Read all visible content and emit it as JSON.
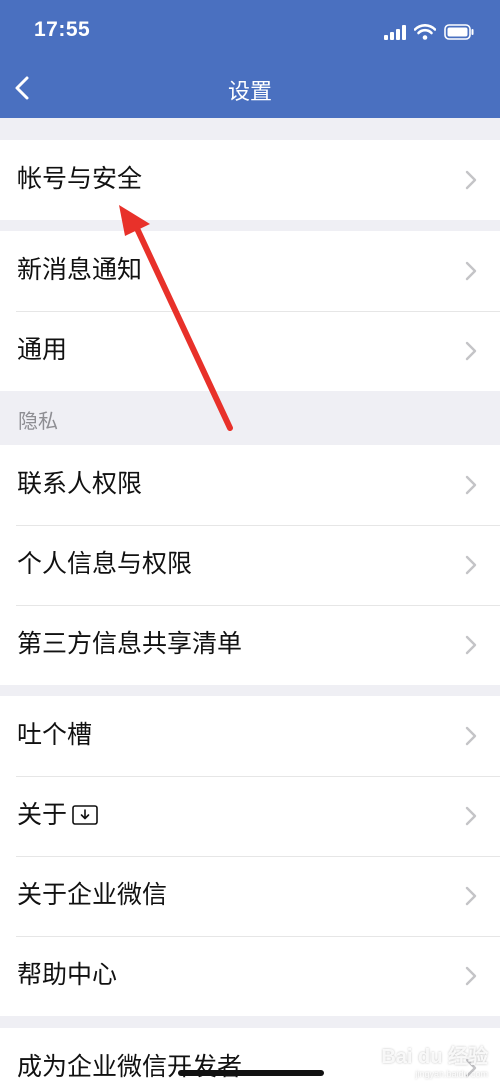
{
  "status_bar": {
    "time": "17:55",
    "icons": [
      "signal-icon",
      "wifi-icon",
      "battery-icon"
    ]
  },
  "nav": {
    "title": "设置",
    "back_icon": "chevron-left-icon"
  },
  "groups": [
    {
      "items": [
        {
          "label": "帐号与安全"
        }
      ]
    },
    {
      "items": [
        {
          "label": "新消息通知"
        },
        {
          "label": "通用"
        }
      ]
    },
    {
      "section_label": "隐私",
      "items": [
        {
          "label": "联系人权限"
        },
        {
          "label": "个人信息与权限"
        },
        {
          "label": "第三方信息共享清单"
        }
      ]
    },
    {
      "items": [
        {
          "label": "吐个槽"
        },
        {
          "label": "关于",
          "icon": "download-box-icon"
        },
        {
          "label": "关于企业微信"
        },
        {
          "label": "帮助中心"
        }
      ]
    },
    {
      "items": [
        {
          "label": "成为企业微信开发者"
        }
      ]
    }
  ],
  "watermark": {
    "brand": "Bai du 经验",
    "sub": "jingyan.baidu.com"
  },
  "colors": {
    "header": "#4a70c0",
    "annotation_arrow": "#e8312a"
  }
}
